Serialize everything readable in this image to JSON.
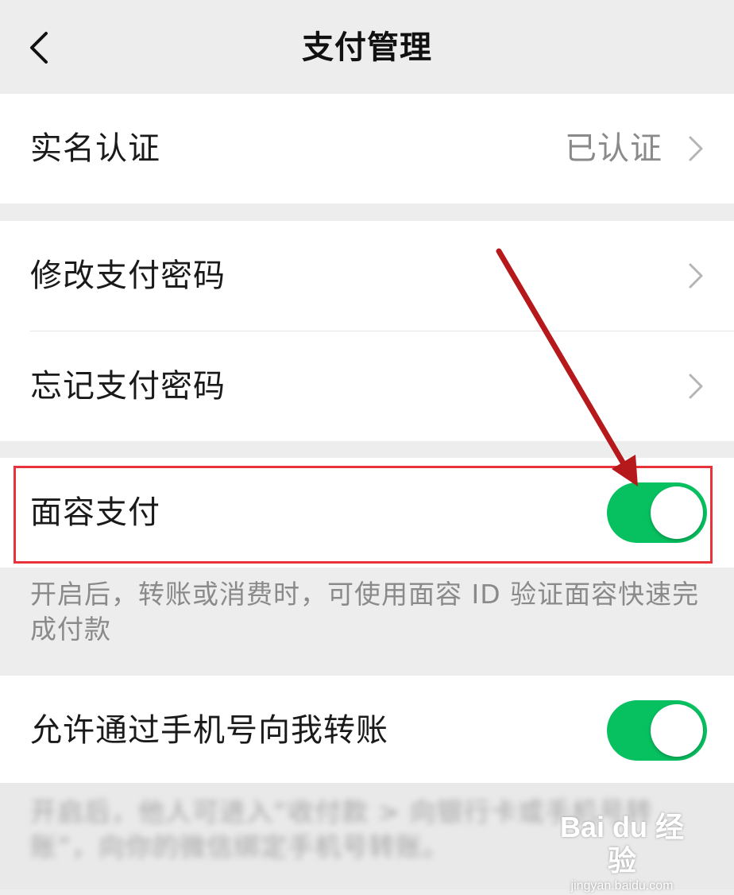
{
  "nav": {
    "title": "支付管理",
    "back_icon": "chevron-left-icon"
  },
  "rows": {
    "real_name": {
      "label": "实名认证",
      "value": "已认证"
    },
    "change_password": {
      "label": "修改支付密码"
    },
    "forgot_password": {
      "label": "忘记支付密码"
    },
    "face_pay": {
      "label": "面容支付",
      "enabled": true
    },
    "phone_transfer": {
      "label": "允许通过手机号向我转账",
      "enabled": true
    }
  },
  "notes": {
    "face_pay": "开启后，转账或消费时，可使用面容 ID 验证面容快速完成付款",
    "phone_transfer": "开启后，他人可进入“收付款 > 向银行卡或手机号转账”，向你的微信绑定手机号转账。"
  },
  "annotation": {
    "highlight_color": "#e8323c",
    "arrow_color": "#b5191c"
  },
  "watermark": {
    "brand": "Bai du 经验",
    "site": "jingyan.baidu.com"
  },
  "colors": {
    "switch_on": "#07c160",
    "background": "#ededed",
    "cell": "#ffffff",
    "secondary_text": "#8a8a8a"
  }
}
